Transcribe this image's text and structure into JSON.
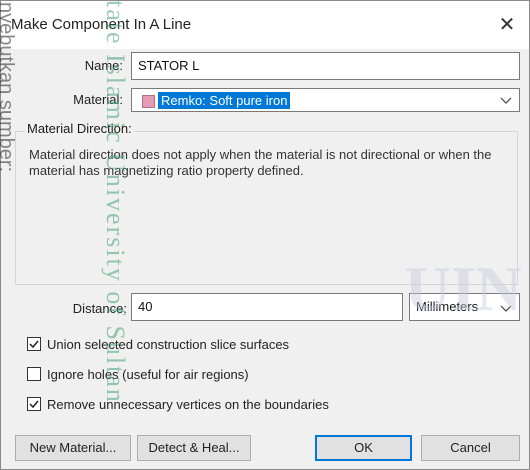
{
  "window": {
    "title": "Make Component In A Line",
    "close_glyph": "✕"
  },
  "form": {
    "name_label": "Name:",
    "name_value": "STATOR L",
    "material_label": "Material:",
    "material_value": "Remko: Soft pure iron",
    "material_swatch_color": "#e59bb4",
    "material_direction_title": "Material Direction:",
    "material_direction_note": "Material direction does not apply when the material is not directional or when the material has magnetizing ratio property defined.",
    "distance_label": "Distance:",
    "distance_value": "40",
    "units_value": "Millimeters"
  },
  "options": [
    {
      "label": "Union selected construction slice surfaces",
      "checked": true
    },
    {
      "label": "Ignore holes (useful for air regions)",
      "checked": false
    },
    {
      "label": "Remove unnecessary vertices on the boundaries",
      "checked": true
    }
  ],
  "buttons": {
    "new_material": "New Material...",
    "detect_heal": "Detect & Heal...",
    "ok": "OK",
    "cancel": "Cancel"
  },
  "watermarks": {
    "vertical_text": "tate Islamic University of Sultan",
    "side_text": "nyebutkan sumber:",
    "corner_text": "UIN"
  },
  "colors": {
    "accent": "#0078d7",
    "dialog_bg": "#f0f0f0"
  },
  "icons": {
    "close": "close-icon",
    "dropdown": "chevron-down-icon",
    "check": "checkmark-icon"
  }
}
